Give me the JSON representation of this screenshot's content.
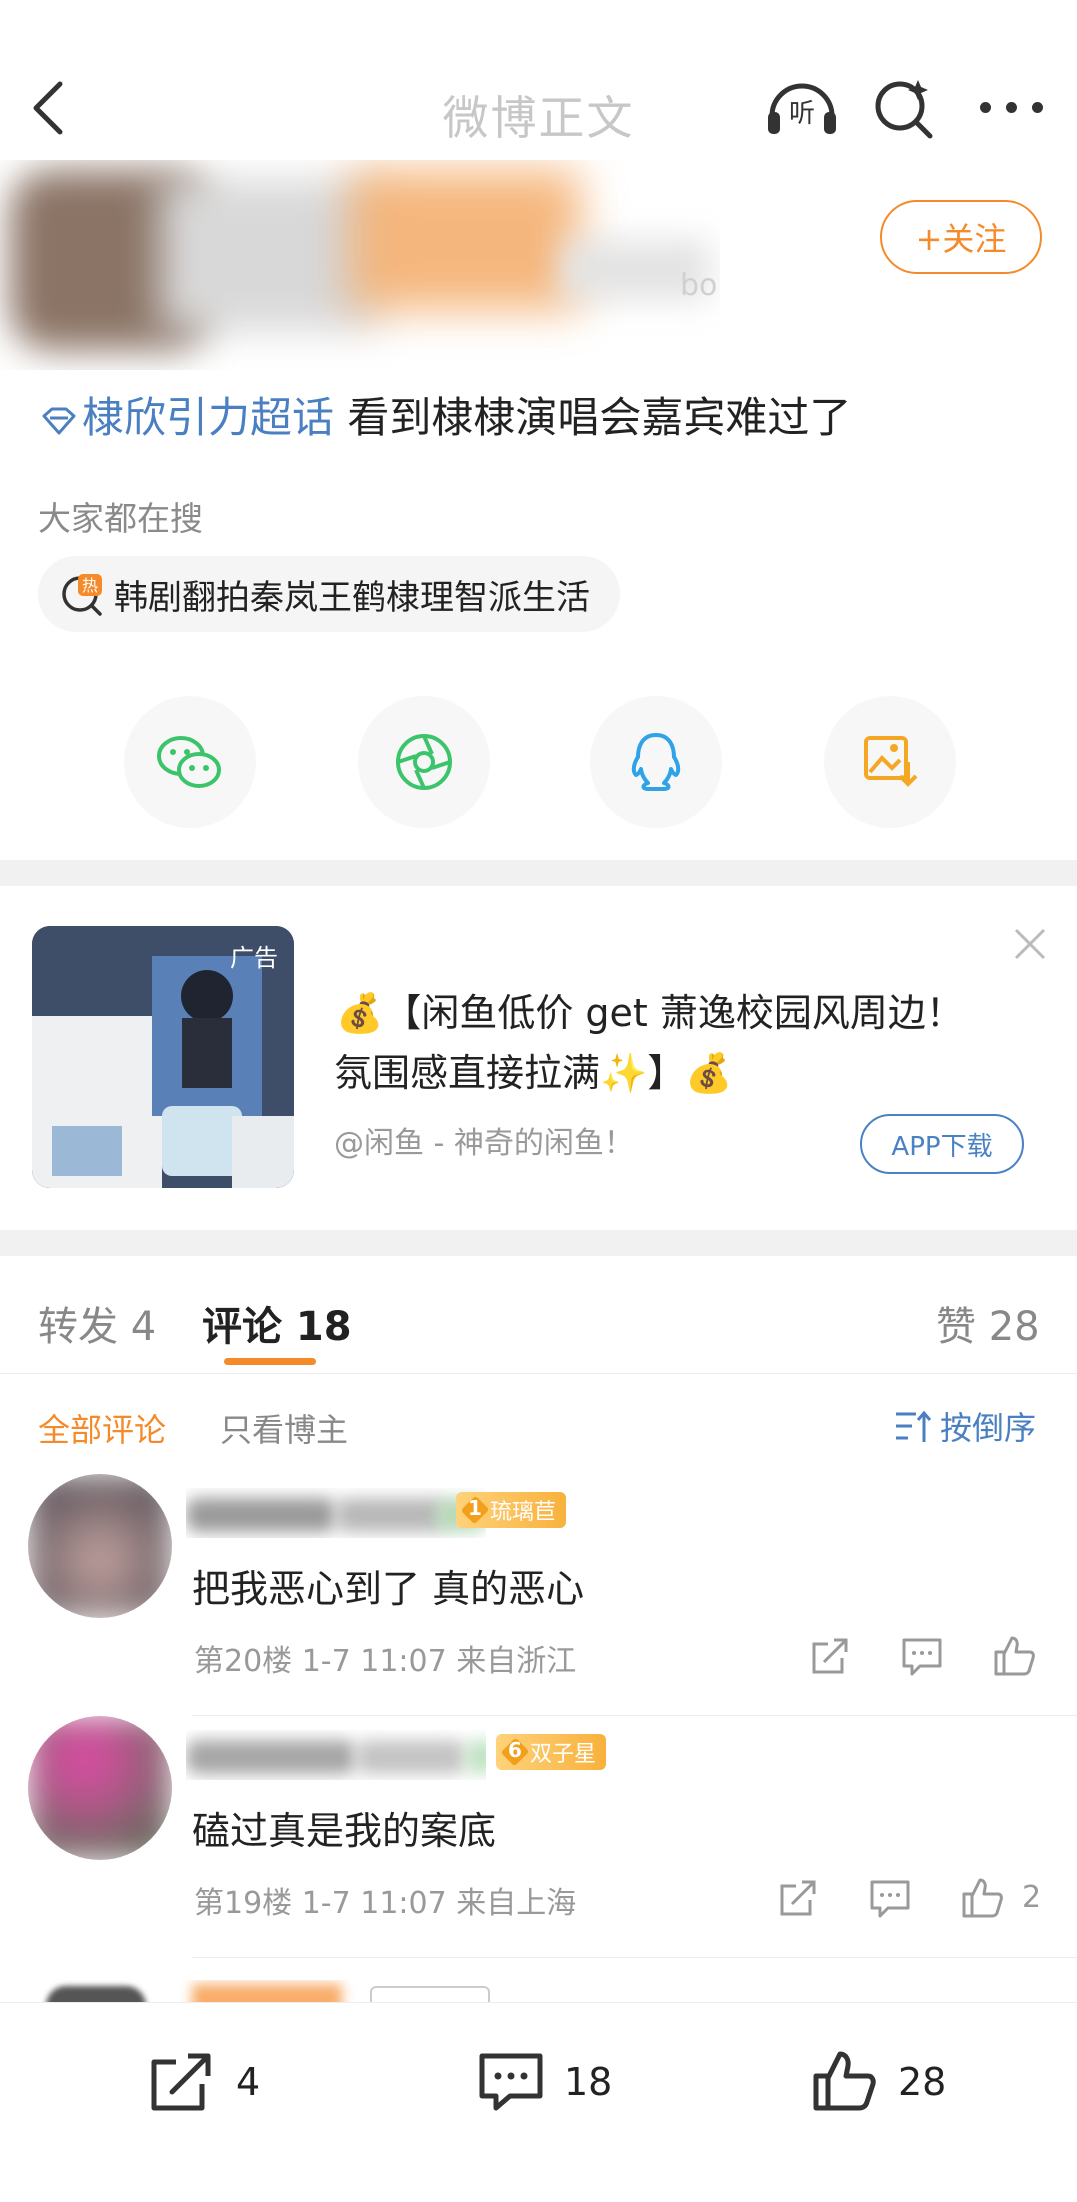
{
  "nav": {
    "title": "微博正文",
    "listen_label": "听",
    "icons": [
      "back-icon",
      "listen-icon",
      "super-search-icon",
      "more-icon"
    ]
  },
  "author": {
    "partial_text": "bo",
    "follow_label": "+关注"
  },
  "post": {
    "topic": "棣欣引力超话",
    "text": "看到棣棣演唱会嘉宾难过了"
  },
  "trending": {
    "label": "大家都在搜",
    "hot_badge": "热",
    "item": "韩剧翻拍秦岚王鹤棣理智派生活"
  },
  "share_icons": [
    "wechat-icon",
    "moments-icon",
    "qq-icon",
    "save-image-icon"
  ],
  "ad": {
    "tag": "广告",
    "line1": "💰【闲鱼低价 get 萧逸校园风周边！",
    "line2": "氛围感直接拉满✨】💰",
    "source": "@闲鱼 - 神奇的闲鱼！",
    "button": "APP下载"
  },
  "tabs": {
    "repost": "转发 4",
    "comment": "评论 18",
    "like": "赞 28"
  },
  "filter": {
    "all": "全部评论",
    "only_author": "只看博主",
    "sort": "按倒序"
  },
  "comments": [
    {
      "medal_level": "1",
      "medal_name": "琉璃苣",
      "text": "把我恶心到了 真的恶心",
      "meta": "第20楼 1-7 11:07 来自浙江",
      "likes": ""
    },
    {
      "medal_level": "6",
      "medal_name": "双子星",
      "text": "磕过真是我的案底",
      "meta": "第19楼 1-7 11:07 来自上海",
      "likes": "2"
    }
  ],
  "bottom_bar": {
    "reposts": "4",
    "comments": "18",
    "likes": "28"
  },
  "colors": {
    "accent_orange": "#f58a2b",
    "link_blue": "#4a7fc1",
    "wechat_green": "#3cc46b",
    "qq_blue": "#2fa3e6",
    "save_orange": "#f5a623"
  }
}
